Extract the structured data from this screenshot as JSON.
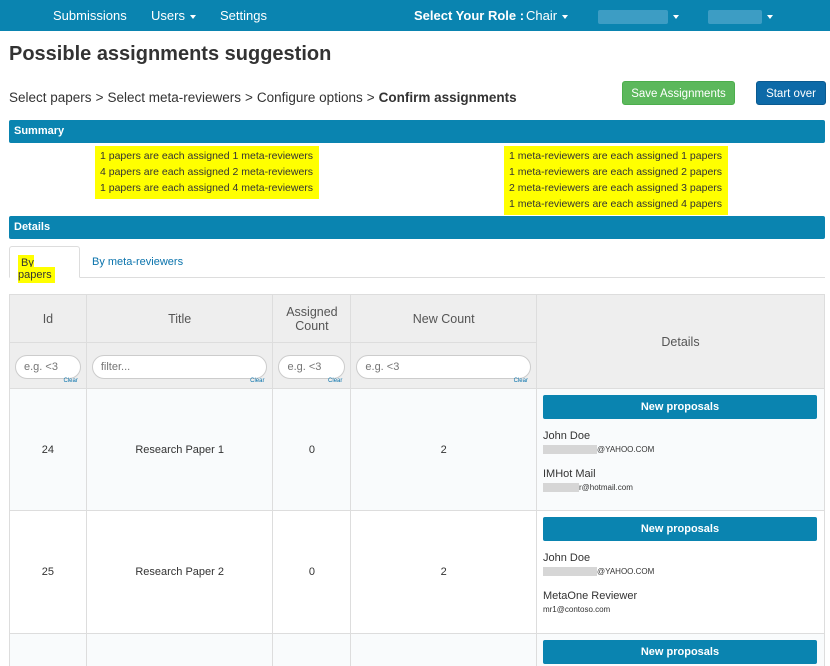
{
  "nav": {
    "submissions": "Submissions",
    "users": "Users",
    "settings": "Settings",
    "role_label": "Select Your Role :",
    "role_value": "Chair"
  },
  "page_title": "Possible assignments suggestion",
  "breadcrumb": {
    "step1": "Select papers",
    "step2": "Select meta-reviewers",
    "step3": "Configure options",
    "step4": "Confirm assignments",
    "separator": ">"
  },
  "buttons": {
    "save": "Save Assignments",
    "start_over": "Start over"
  },
  "summary": {
    "title": "Summary",
    "left": [
      "1 papers are each assigned 1 meta-reviewers",
      "4 papers are each assigned 2 meta-reviewers",
      "1 papers are each assigned 4 meta-reviewers"
    ],
    "right": [
      "1 meta-reviewers are each assigned 1 papers",
      "1 meta-reviewers are each assigned 2 papers",
      "2 meta-reviewers are each assigned 3 papers",
      "1 meta-reviewers are each assigned 4 papers"
    ]
  },
  "details": {
    "title": "Details",
    "tabs": [
      "By papers",
      "By meta-reviewers"
    ]
  },
  "table": {
    "headers": {
      "id": "Id",
      "title": "Title",
      "assigned_count": "Assigned Count",
      "new_count": "New Count",
      "details": "Details"
    },
    "filters": {
      "id_placeholder": "e.g. <3",
      "title_placeholder": "filter...",
      "assigned_placeholder": "e.g. <3",
      "new_placeholder": "e.g. <3",
      "clear": "Clear"
    },
    "proposal_label": "New proposals",
    "rows": [
      {
        "id": "24",
        "title": "Research Paper 1",
        "assigned": "0",
        "new_count": "2",
        "reviewers": [
          {
            "name": "John Doe",
            "email_suffix": "@YAHOO.COM"
          },
          {
            "name": "IMHot Mail",
            "email_suffix": "r@hotmail.com"
          }
        ]
      },
      {
        "id": "25",
        "title": "Research Paper 2",
        "assigned": "0",
        "new_count": "2",
        "reviewers": [
          {
            "name": "John Doe",
            "email_suffix": "@YAHOO.COM"
          },
          {
            "name": "MetaOne Reviewer",
            "email": "mr1@contoso.com"
          }
        ]
      }
    ]
  }
}
